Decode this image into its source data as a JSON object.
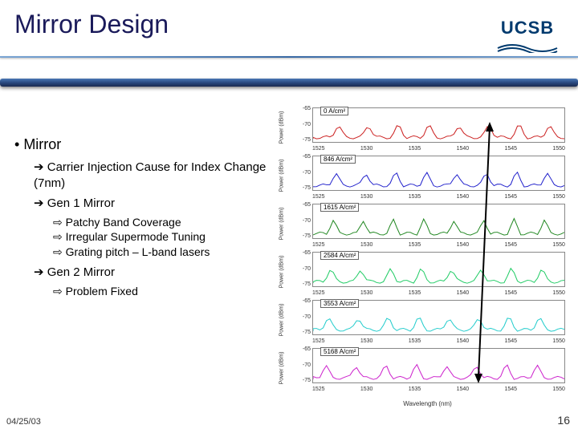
{
  "header": {
    "title": "Mirror Design",
    "logo": "UCSB"
  },
  "content": {
    "bullet": "Mirror",
    "sub1": "Carrier Injection Cause for Index Change (7nm)",
    "sub2": "Gen 1 Mirror",
    "sub2_items": [
      "Patchy Band Coverage",
      "Irregular Supermode Tuning",
      "Grating pitch – L-band lasers"
    ],
    "sub3": "Gen 2 Mirror",
    "sub3_items": [
      "Problem Fixed"
    ]
  },
  "footer": {
    "date": "04/25/03",
    "page": "16"
  },
  "chart_data": {
    "type": "line",
    "xlabel": "Wavelength (nm)",
    "ylabel": "Power (dBm)",
    "x_ticks": [
      1525,
      1530,
      1535,
      1540,
      1545,
      1550
    ],
    "y_ticks": [
      -65,
      -70,
      -75
    ],
    "panels": [
      {
        "label": "0 A/cm²",
        "color": "#cc2222"
      },
      {
        "label": "846 A/cm²",
        "color": "#2222cc"
      },
      {
        "label": "1615 A/cm²",
        "color": "#228822"
      },
      {
        "label": "2584 A/cm²",
        "color": "#22cc66"
      },
      {
        "label": "3553 A/cm²",
        "color": "#22cccc"
      },
      {
        "label": "5168 A/cm²",
        "color": "#cc22cc"
      }
    ],
    "note": "Stacked spectral power plots showing reflection peaks shifting with carrier injection current density; arrow indicates peak wavelength shift across panels."
  }
}
